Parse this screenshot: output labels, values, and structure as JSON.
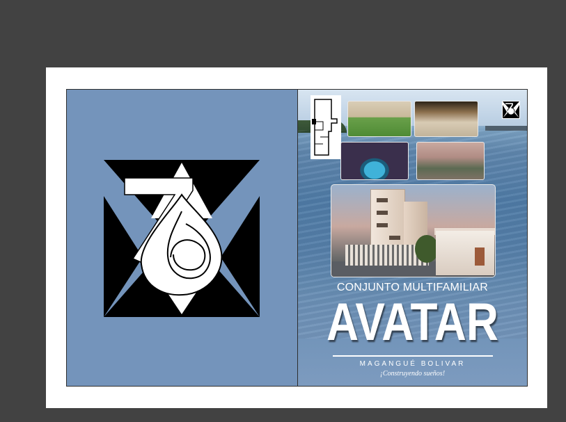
{
  "window": {
    "canvas_color": "#424242",
    "artboard_color": "#ffffff"
  },
  "back_cover": {
    "background": "#7494bb",
    "logo": {
      "icon": "seventy-six-logo-icon"
    }
  },
  "front_cover": {
    "images": {
      "floorplan": "floorplan-icon",
      "court": "soccer-court-photo",
      "terrace": "terrace-photo",
      "pool": "indoor-pool-photo",
      "patio": "patio-photo",
      "building": "building-render-photo"
    },
    "corner_logo": "seventy-six-logo-icon",
    "subtitle": "CONJUNTO MULTIFAMILIAR",
    "title": "AVATAR",
    "location": "MAGANGUÉ BOLIVAR",
    "tagline": "¡Construyendo sueños!"
  }
}
